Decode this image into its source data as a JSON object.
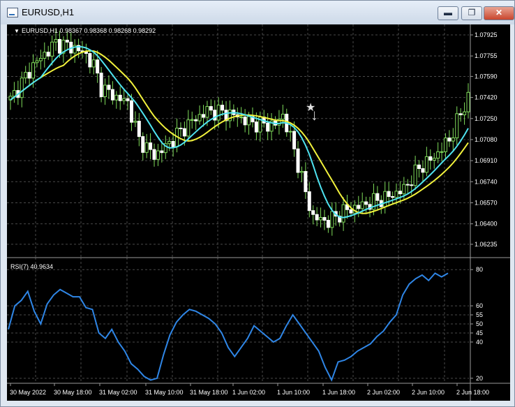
{
  "window": {
    "title": "EURUSD,H1",
    "minimize_glyph": "▬",
    "maximize_glyph": "❐",
    "close_glyph": "✕"
  },
  "colors": {
    "background": "#000000",
    "grid": "#4a4a4a",
    "candle_bull": "#d7f5b0",
    "candle_bear": "#ffffff",
    "ma_fast": "#4fe3f0",
    "ma_slow": "#f2f23c",
    "rsi": "#2f86e6",
    "text": "#ffffff"
  },
  "header": {
    "triangle_glyph": "▼",
    "text": "EURUSD,H1  0.98367 0.98368 0.98268 0.98292"
  },
  "rsi_label": "RSI(7) 40.9634",
  "markers": {
    "star_glyph": "★",
    "arrow_glyph": "↓"
  },
  "chart_data": [
    {
      "type": "candlestick",
      "symbol": "EURUSD",
      "timeframe": "H1",
      "ylim": [
        1.0615,
        1.0797
      ],
      "y_ticks": [
        "1.07925",
        "1.07755",
        "1.07590",
        "1.07420",
        "1.07250",
        "1.07080",
        "1.06910",
        "1.06740",
        "1.06570",
        "1.06400",
        "1.06235"
      ],
      "overlays": [
        {
          "name": "MA fast",
          "color": "cyan"
        },
        {
          "name": "MA slow",
          "color": "yellow"
        }
      ]
    },
    {
      "type": "line",
      "indicator": "RSI",
      "period": 7,
      "current": 40.9634,
      "ylim": [
        18,
        82
      ],
      "y_ticks": [
        "80",
        "60",
        "55",
        "50",
        "45",
        "40",
        "20"
      ],
      "series": [
        {
          "values": [
            47,
            60,
            63,
            68,
            57,
            50,
            61,
            66,
            69,
            67,
            65,
            65,
            59,
            58,
            45,
            42,
            47,
            40,
            35,
            28,
            25,
            21,
            19,
            20,
            33,
            44,
            51,
            55,
            58,
            57,
            55,
            53,
            50,
            45,
            37,
            32,
            37,
            42,
            49,
            46,
            43,
            40,
            42,
            49,
            55,
            50,
            45,
            40,
            35,
            26,
            19,
            29,
            30,
            32,
            35,
            37,
            39,
            43,
            46,
            51,
            55,
            66,
            72,
            75,
            77,
            74,
            78,
            76,
            78
          ]
        }
      ]
    }
  ],
  "x_labels": [
    "30 May 2022",
    "30 May 18:00",
    "31 May 02:00",
    "31 May 10:00",
    "31 May 18:00",
    "1 Jun 02:00",
    "1 Jun 10:00",
    "1 Jun 18:00",
    "2 Jun 02:00",
    "2 Jun 10:00",
    "2 Jun 18:00"
  ]
}
